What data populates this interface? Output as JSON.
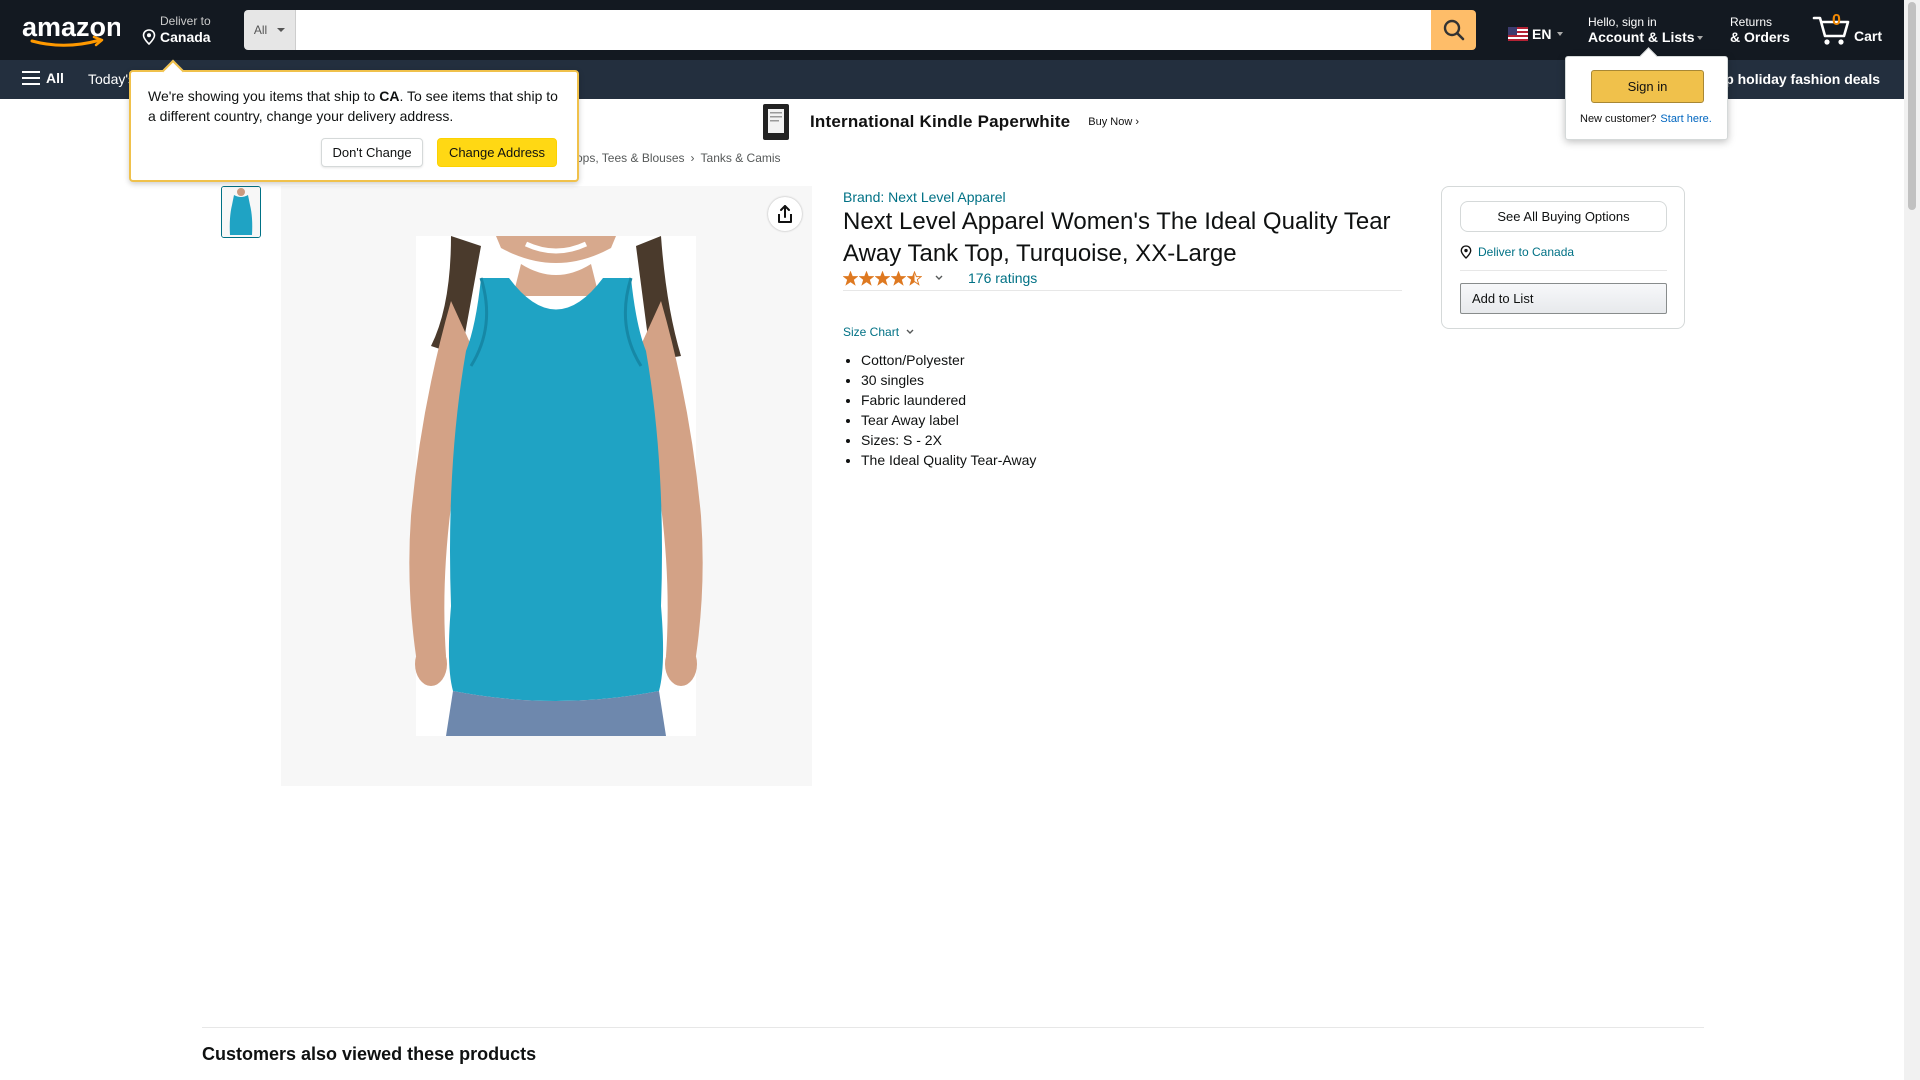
{
  "nav": {
    "deliver_line1": "Deliver to",
    "deliver_line2": "Canada",
    "search_category": "All",
    "search_placeholder": "",
    "language": "EN",
    "account_line1": "Hello, sign in",
    "account_line2": "Account & Lists",
    "returns_line1": "Returns",
    "returns_line2": "& Orders",
    "cart_count": "0",
    "cart_label": "Cart"
  },
  "subnav": {
    "all_label": "All",
    "today_label": "Today's Deals",
    "deal_banner": "Shop holiday fashion deals"
  },
  "banner": {
    "title": "International Kindle Paperwhite",
    "cta": "Buy Now ›"
  },
  "breadcrumb": {
    "items": [
      "Tops, Tees & Blouses",
      "Tanks & Camis"
    ]
  },
  "product": {
    "brand": "Brand: Next Level Apparel",
    "title": "Next Level Apparel Women's The Ideal Quality Tear Away Tank Top, Turquoise, XX-Large",
    "rating_stars": 4.5,
    "ratings_count": "176 ratings",
    "size_chart": "Size Chart",
    "bullets": [
      "Cotton/Polyester",
      "30 singles",
      "Fabric laundered",
      "Tear Away label",
      "Sizes: S - 2X",
      "The Ideal Quality Tear-Away"
    ]
  },
  "buybox": {
    "see_all": "See All Buying Options",
    "deliver_to": "Deliver to Canada",
    "add_to_list": "Add to List"
  },
  "section": {
    "customers_also_viewed": "Customers also viewed these products"
  },
  "ship_popover": {
    "msg_part1": "We're showing you items that ship to ",
    "msg_country": "CA",
    "msg_part2": ". To see items that ship to a different country, change your delivery address.",
    "dont_change": "Don't Change",
    "change_address": "Change Address"
  },
  "signin_popover": {
    "sign_in": "Sign in",
    "new_customer": "New customer?",
    "start_here": "Start here."
  },
  "colors": {
    "nav_dark": "#131921",
    "nav_sub": "#232f3e",
    "search_button": "#febd69",
    "link": "#007185",
    "star": "#de7921",
    "shirt": "#1fa3c4",
    "button_yellow": "#ffd814"
  }
}
